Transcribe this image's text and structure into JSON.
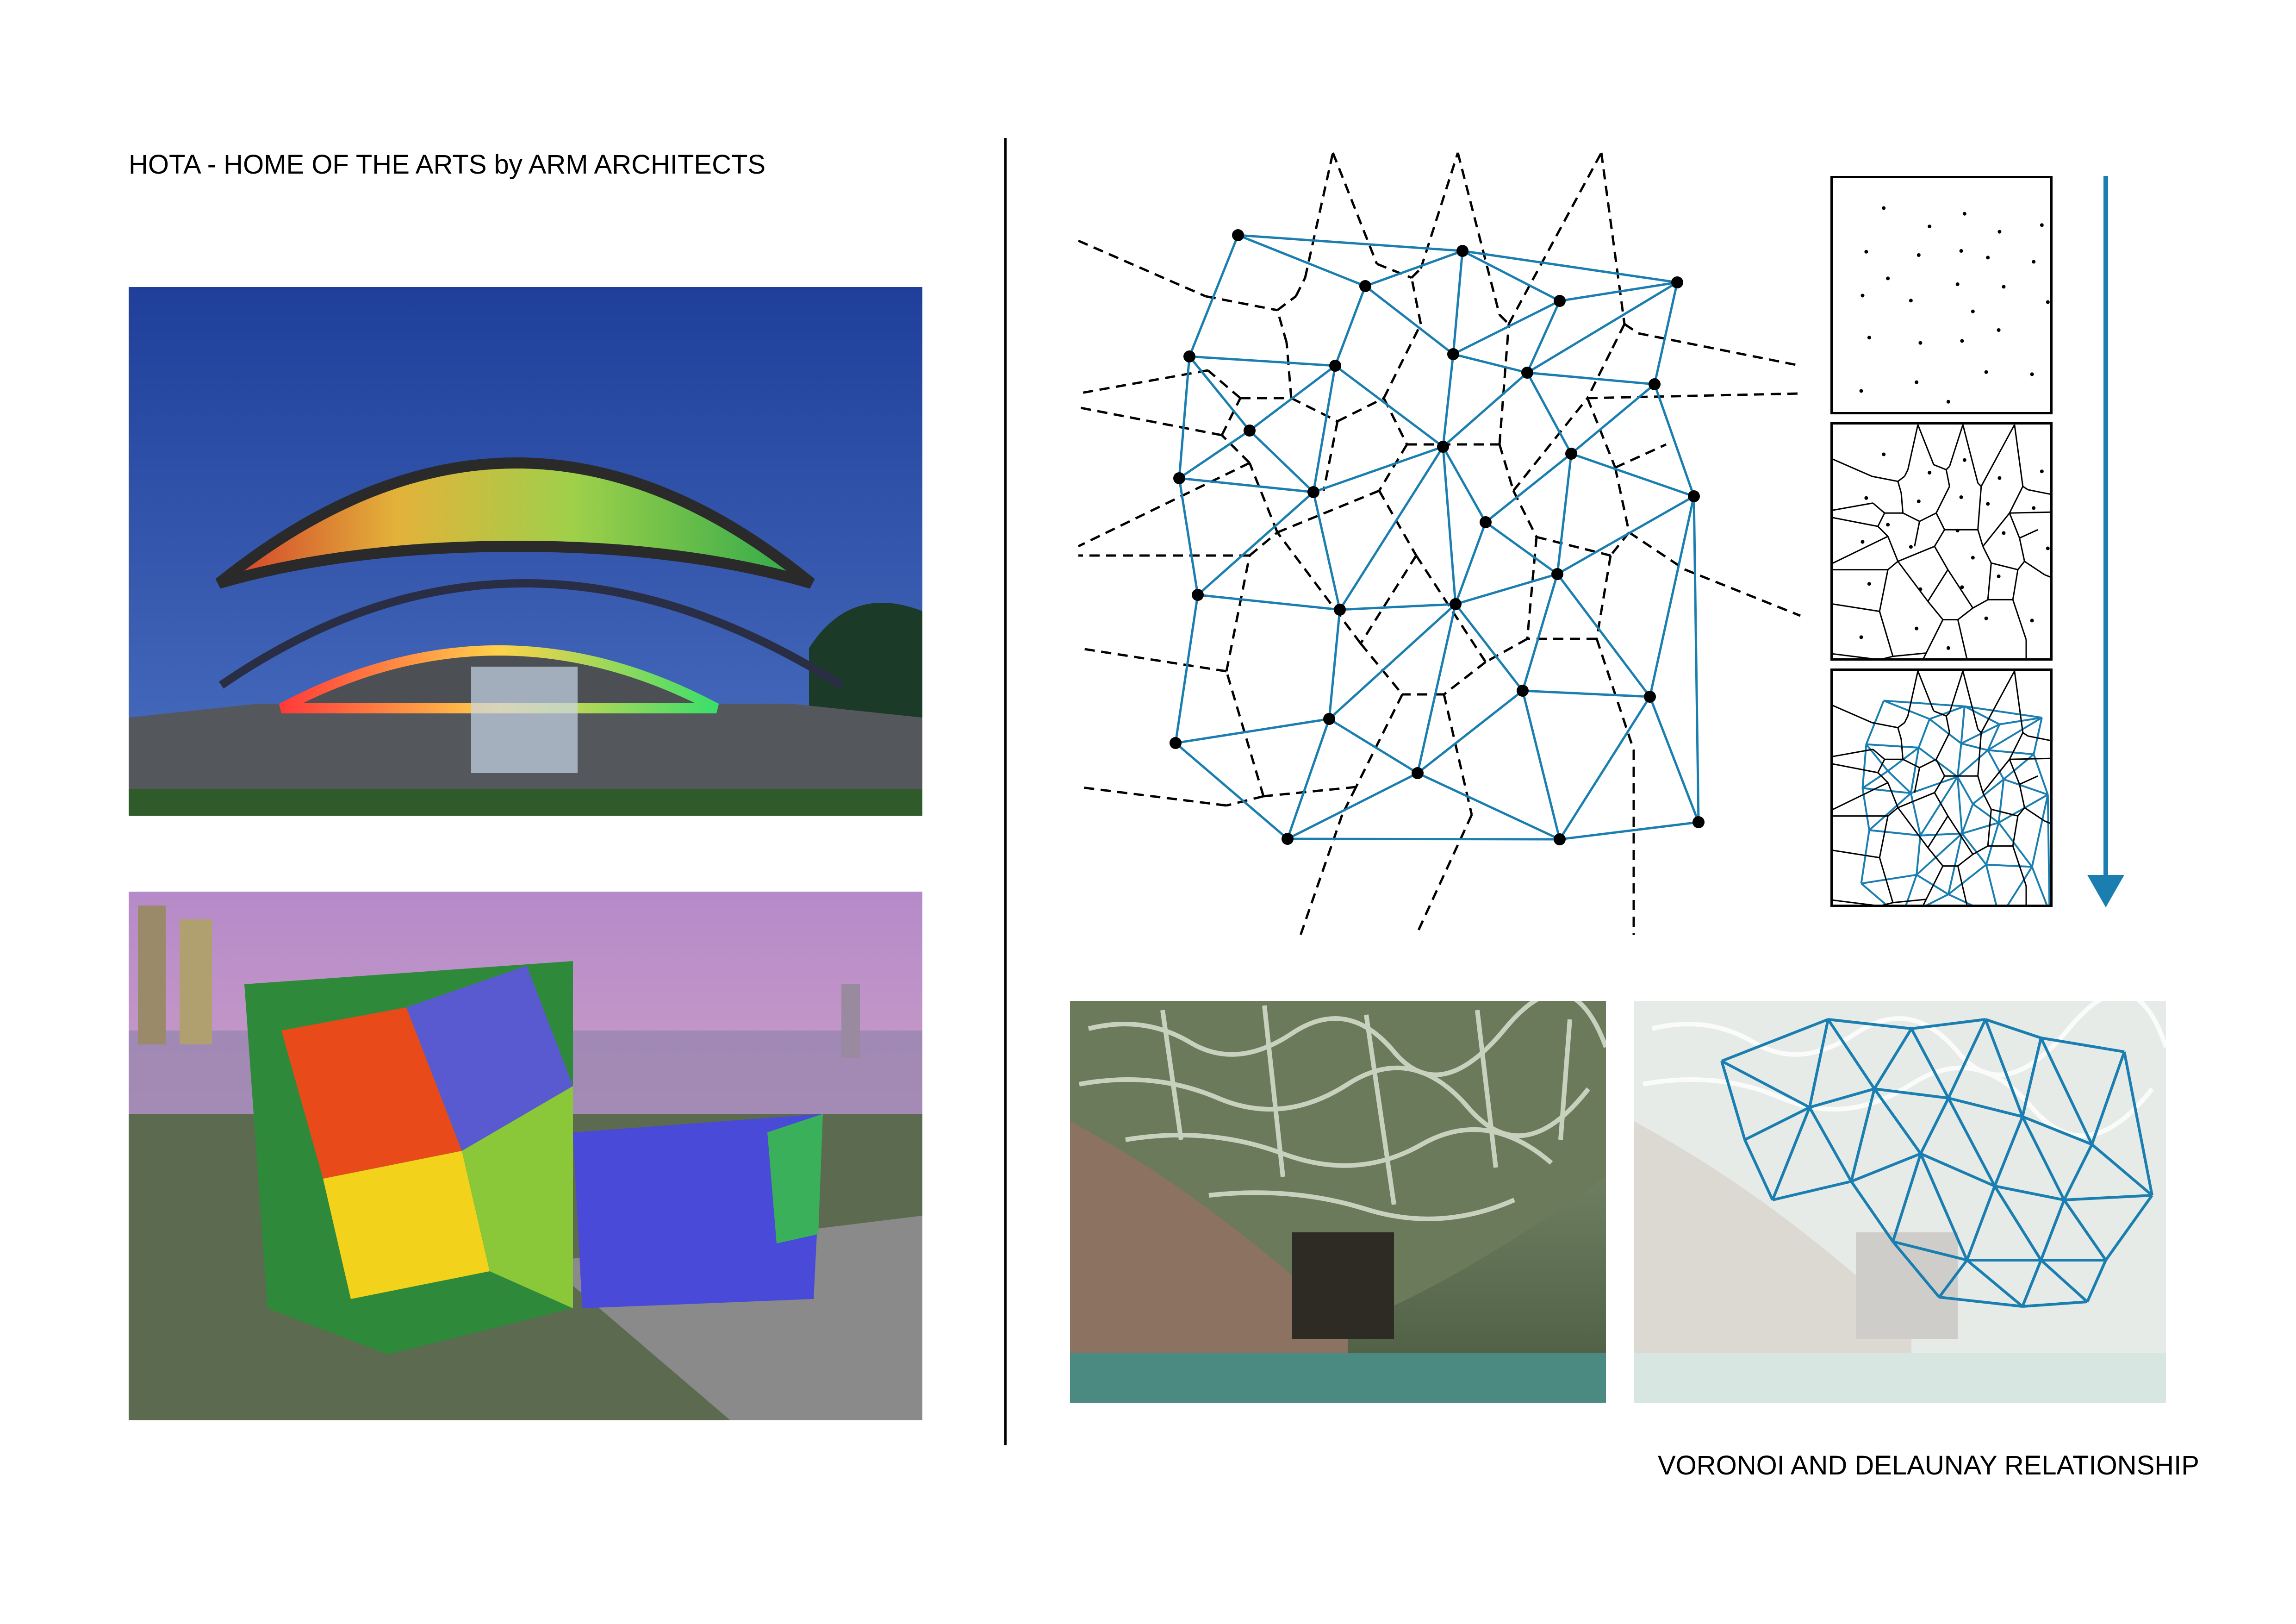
{
  "left_title": "HOTA - HOME OF THE ARTS by ARM ARCHITECTS",
  "right_caption": "VORONOI AND DELAUNAY RELATIONSHIP",
  "colors": {
    "delaunay_edge": "#1a7fb0",
    "voronoi_edge": "#000000",
    "arrow": "#1a7fb0",
    "point": "#000000"
  }
}
